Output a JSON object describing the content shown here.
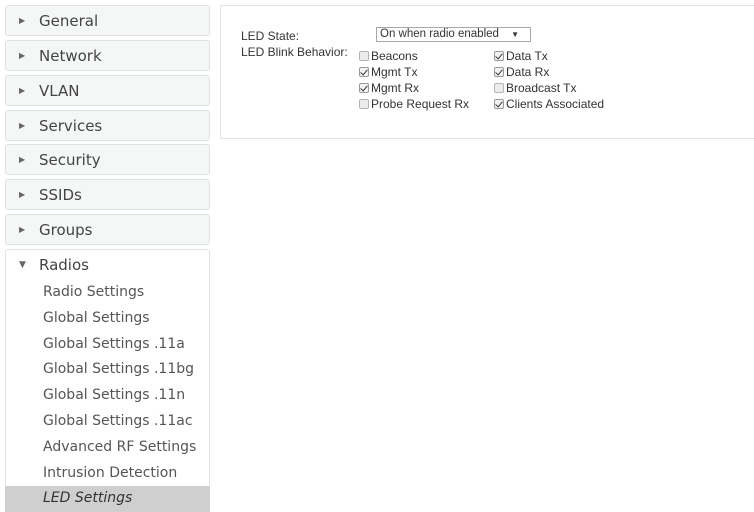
{
  "sidebar": {
    "items": [
      {
        "label": "General"
      },
      {
        "label": "Network"
      },
      {
        "label": "VLAN"
      },
      {
        "label": "Services"
      },
      {
        "label": "Security"
      },
      {
        "label": "SSIDs"
      },
      {
        "label": "Groups"
      },
      {
        "label": "Radios"
      }
    ],
    "radios_sub": [
      {
        "label": "Radio Settings"
      },
      {
        "label": "Global Settings"
      },
      {
        "label": "Global Settings .11a"
      },
      {
        "label": "Global Settings .11bg"
      },
      {
        "label": "Global Settings .11n"
      },
      {
        "label": "Global Settings .11ac"
      },
      {
        "label": "Advanced RF Settings"
      },
      {
        "label": "Intrusion Detection"
      },
      {
        "label": "LED Settings"
      }
    ]
  },
  "led": {
    "state_label": "LED State:",
    "state_value": "On when radio enabled",
    "blink_label": "LED Blink Behavior:",
    "options": [
      {
        "label": "Beacons",
        "checked": false
      },
      {
        "label": "Data Tx",
        "checked": true
      },
      {
        "label": "Mgmt Tx",
        "checked": true
      },
      {
        "label": "Data Rx",
        "checked": true
      },
      {
        "label": "Mgmt Rx",
        "checked": true
      },
      {
        "label": "Broadcast Tx",
        "checked": false
      },
      {
        "label": "Probe Request Rx",
        "checked": false
      },
      {
        "label": "Clients Associated",
        "checked": true
      }
    ]
  }
}
